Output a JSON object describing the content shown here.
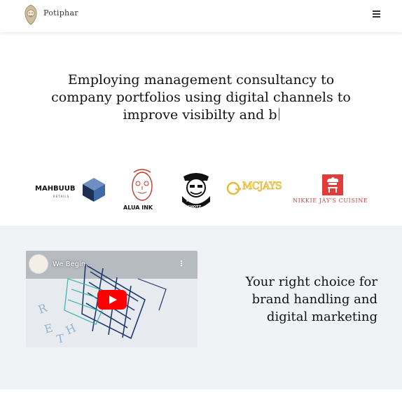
{
  "header": {
    "brand": "Potiphar",
    "logo_icon": "lion-crest-icon",
    "menu_icon": "hamburger-menu-icon"
  },
  "hero": {
    "headline_line1": "Employing management consultancy to",
    "headline_line2": "company portfolios using digital channels to",
    "headline_line3": "improve visibilty and b"
  },
  "partners": {
    "mahbuub": {
      "name": "MAHBUUB",
      "sub": "RETAILS"
    },
    "alua": {
      "name": "ALUA INK"
    },
    "poppin": {
      "name": "POPPIN",
      "sub": "SHOTZ"
    },
    "mcjays": {
      "name": "MCJAYS"
    },
    "nikkie": {
      "name": "NIKKIE JAY'S CUISINE"
    }
  },
  "video": {
    "title": "We Begin...",
    "play_icon": "youtube-play-icon",
    "more_icon": "more-vertical-icon"
  },
  "tagline": {
    "line1": "Your right choice for",
    "line2": "brand handling and",
    "line3": "digital marketing"
  },
  "colors": {
    "band_bg": "#f1f2f6",
    "youtube_red": "#ff0000",
    "mcjays_gold": "#e6bb3a",
    "nikkie_red": "#e23b3b",
    "mahbuub_blue": "#4a6fa5"
  }
}
